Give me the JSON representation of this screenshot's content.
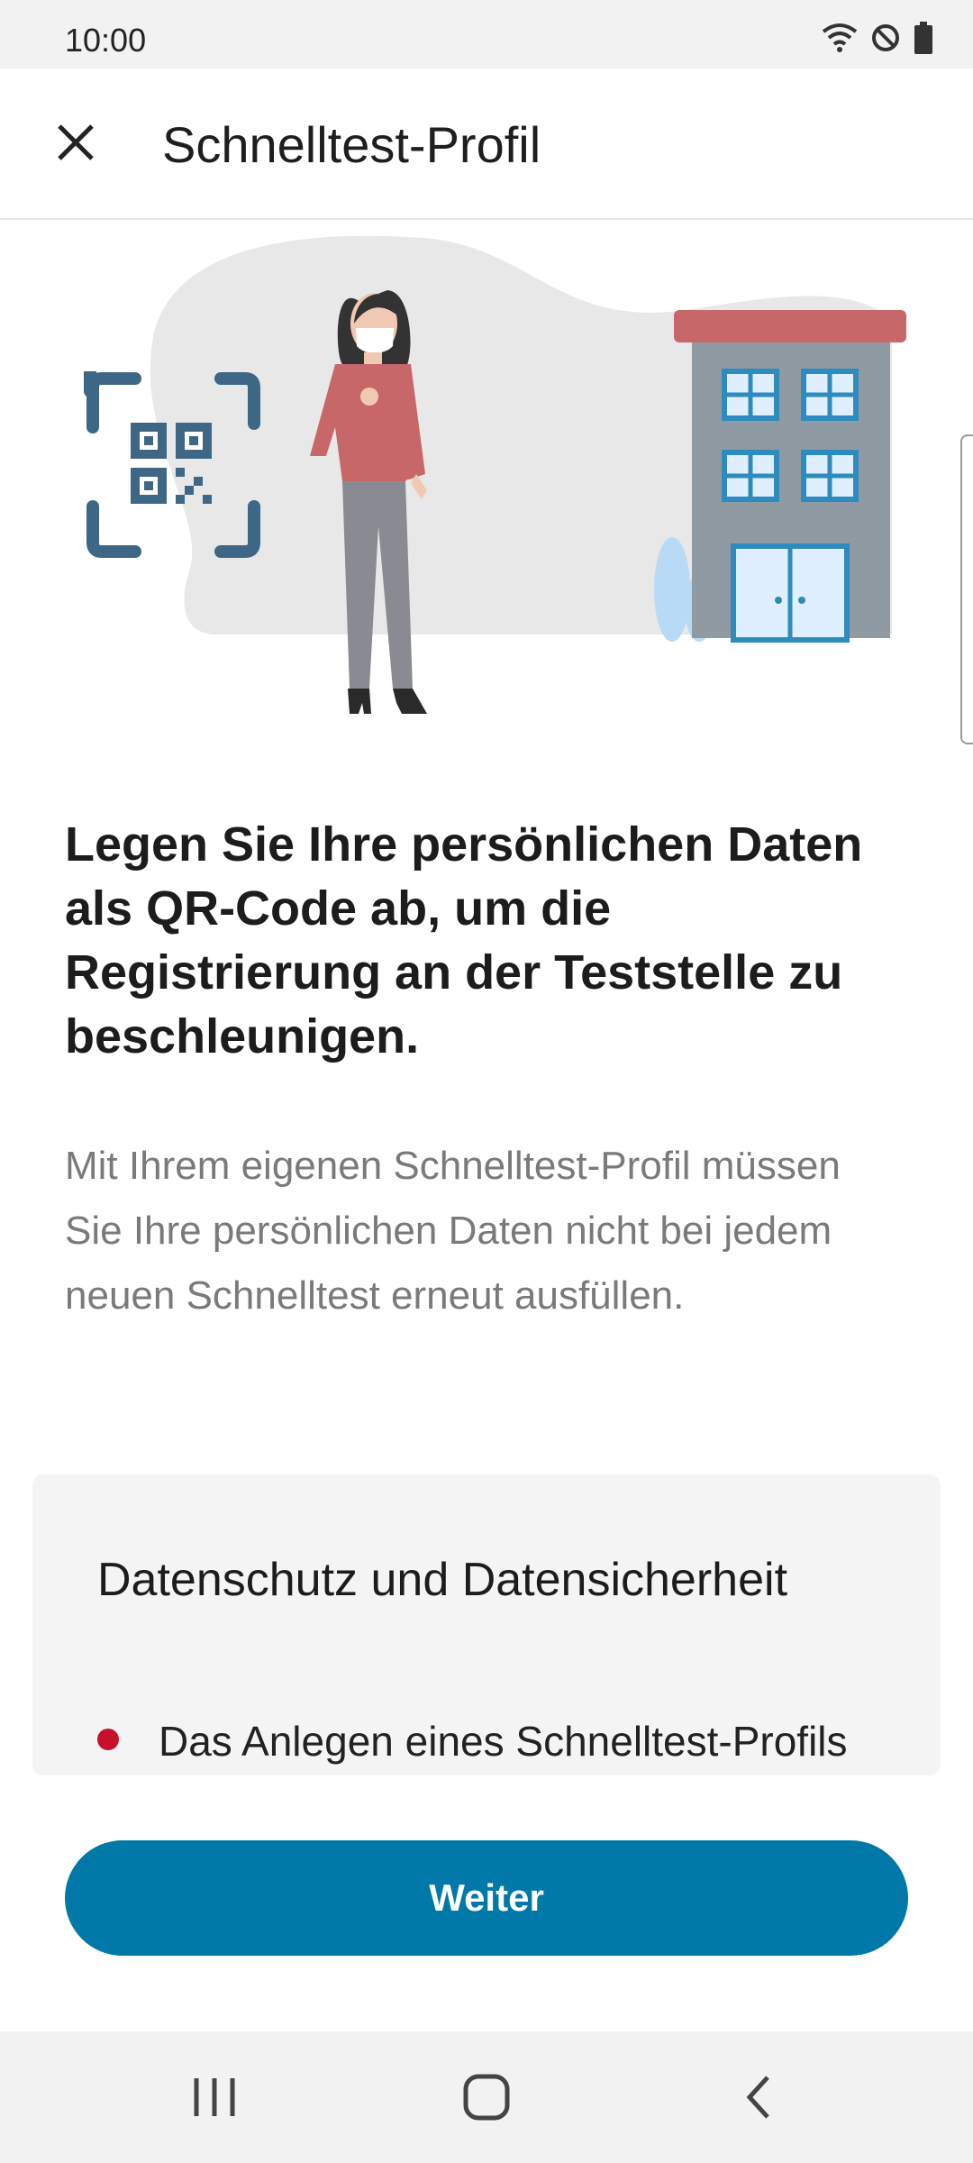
{
  "status_bar": {
    "time": "10:00",
    "icons": [
      "wifi-icon",
      "do-not-disturb-icon",
      "battery-icon"
    ]
  },
  "app_bar": {
    "close_icon": "close-icon",
    "title": "Schnelltest-Profil"
  },
  "illustration": {
    "elements": [
      "qr-code-icon",
      "woman-with-mask",
      "building",
      "plant"
    ]
  },
  "content": {
    "headline": "Legen Sie Ihre persönlichen Daten als QR-Code ab, um die Registrierung an der Teststelle zu beschleunigen.",
    "body": "Mit Ihrem eigenen Schnelltest-Profil müssen Sie Ihre persönlichen Daten nicht bei jedem neuen Schnelltest erneut ausfüllen."
  },
  "privacy": {
    "title": "Datenschutz und Datensicherheit",
    "items": [
      {
        "text": "Das Anlegen eines Schnelltest-Profils"
      }
    ]
  },
  "actions": {
    "next_label": "Weiter"
  },
  "nav_bar": {
    "buttons": [
      "recents-icon",
      "home-icon",
      "back-icon"
    ]
  },
  "colors": {
    "accent": "#0079a8",
    "bullet": "#c6102e",
    "card_background": "#f4f4f4"
  }
}
